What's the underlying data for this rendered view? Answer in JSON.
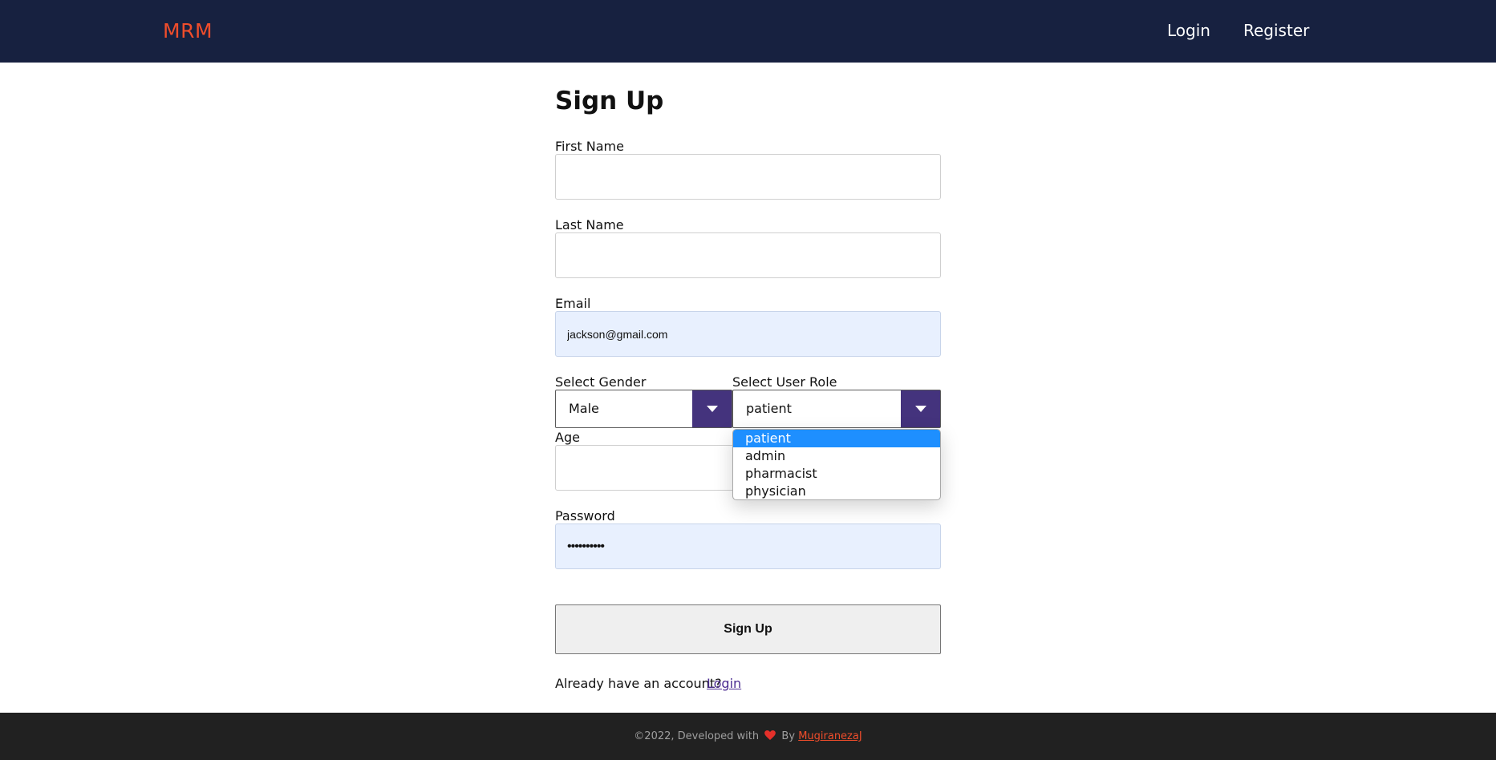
{
  "header": {
    "brand": "MRM",
    "nav": {
      "login": "Login",
      "register": "Register"
    }
  },
  "form": {
    "title": "Sign Up",
    "first_name": {
      "label": "First Name",
      "value": ""
    },
    "last_name": {
      "label": "Last Name",
      "value": ""
    },
    "email": {
      "label": "Email",
      "value": "jackson@gmail.com"
    },
    "gender": {
      "label": "Select Gender",
      "value": "Male"
    },
    "role": {
      "label": "Select User Role",
      "value": "patient",
      "options": [
        "patient",
        "admin",
        "pharmacist",
        "physician"
      ],
      "highlighted": "patient"
    },
    "age": {
      "label": "Age",
      "value": ""
    },
    "password": {
      "label": "Password",
      "value": "••••••••••"
    },
    "submit_label": "Sign Up",
    "account_prompt": "Already have an account?",
    "login_link": "Login"
  },
  "footer": {
    "text_before": "©2022, Developed with",
    "text_by": "By",
    "author": "MugiranezaJ",
    "heart_icon": "heart-icon"
  },
  "colors": {
    "navbar": "#172140",
    "brand": "#ef4d2b",
    "select_arrow": "#44337d",
    "option_highlight": "#1e8fff",
    "footer": "#212121"
  }
}
